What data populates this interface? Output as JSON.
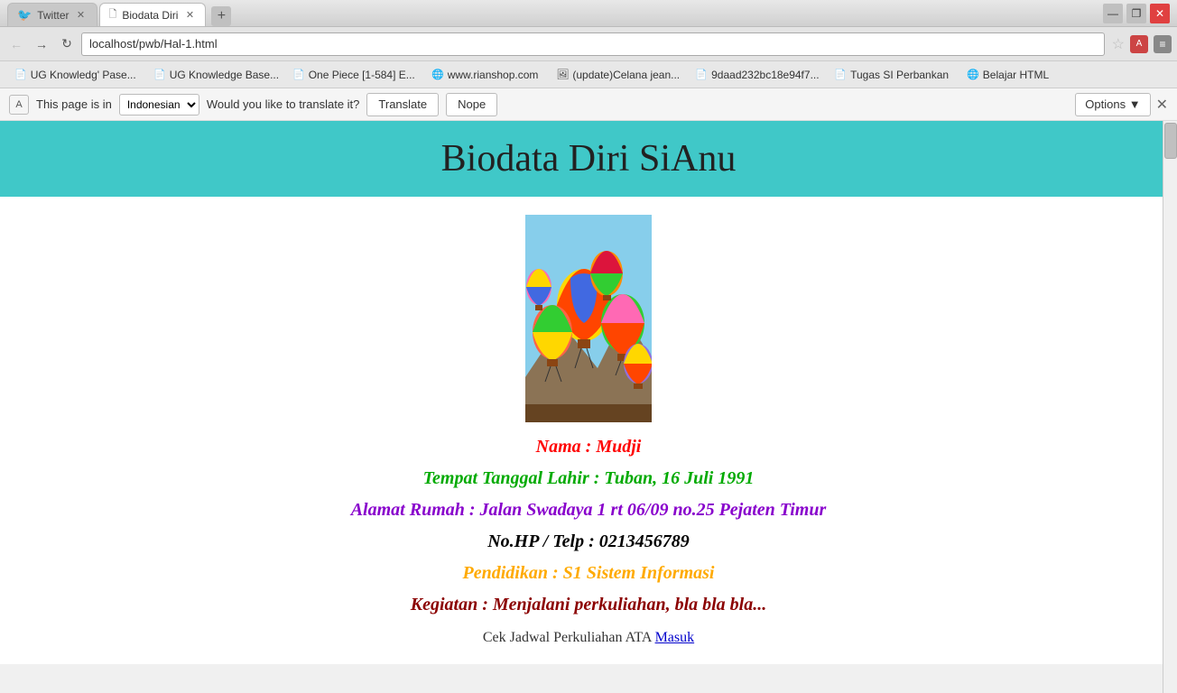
{
  "browser": {
    "tabs": [
      {
        "id": "twitter",
        "label": "Twitter",
        "icon": "twitter",
        "active": false,
        "closeable": true
      },
      {
        "id": "biodata",
        "label": "Biodata Diri",
        "icon": "page",
        "active": true,
        "closeable": true
      }
    ],
    "address": "localhost/pwb/Hal-1.html",
    "bookmarks": [
      {
        "label": "UG Knowledg' Pase...",
        "icon": "📄"
      },
      {
        "label": "UG Knowledge Base...",
        "icon": "📄"
      },
      {
        "label": "One Piece [1-584] E...",
        "icon": "📄"
      },
      {
        "label": "www.rianshop.com",
        "icon": "🌐"
      },
      {
        "label": "(update)Celana jean...",
        "icon": "🖼"
      },
      {
        "label": "9daad232bc18e94f7...",
        "icon": "📄"
      },
      {
        "label": "Tugas SI Perbankan",
        "icon": "📄"
      },
      {
        "label": "Belajar HTML",
        "icon": "🌐"
      }
    ],
    "translation_bar": {
      "page_is_in": "This page is in",
      "language": "Indonesian",
      "question": "Would you like to translate it?",
      "translate_btn": "Translate",
      "nope_btn": "Nope",
      "options_btn": "Options"
    }
  },
  "page": {
    "title": "Biodata Diri SiAnu",
    "header_bg": "#40c8c8",
    "bio": {
      "name_label": "Nama : Mudji",
      "birthdate_label": "Tempat Tanggal Lahir : Tuban, 16 Juli 1991",
      "address_label": "Alamat Rumah : Jalan Swadaya 1 rt 06/09 no.25 Pejaten Timur",
      "phone_label": "No.HP / Telp : 0213456789",
      "education_label": "Pendidikan : S1 Sistem Informasi",
      "activity_label": "Kegiatan : Menjalani perkuliahan, bla bla bla...",
      "link_text": "Cek Jadwal Perkuliahan ATA",
      "link_label": "Masuk"
    }
  }
}
